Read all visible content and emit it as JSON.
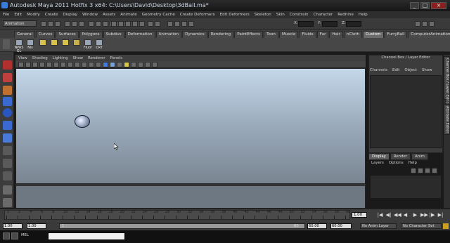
{
  "window": {
    "title": "Autodesk Maya 2011 Hotfix 3 x64: C:\\Users\\David\\Desktop\\3dBall.ma*",
    "buttons": [
      "_",
      "□",
      "×"
    ]
  },
  "menubar": [
    "File",
    "Edit",
    "Modify",
    "Create",
    "Display",
    "Window",
    "Assets",
    "Animate",
    "Geometry Cache",
    "Create Deformers",
    "Edit Deformers",
    "Skeleton",
    "Skin",
    "Constrain",
    "Character",
    "Redhine",
    "Help"
  ],
  "status_line": {
    "mode": "Animation",
    "x_label": "X:",
    "y_label": "Y:",
    "z_label": "Z:"
  },
  "shelf_tabs": [
    "General",
    "Curves",
    "Surfaces",
    "Polygons",
    "Subdivs",
    "Deformation",
    "Animation",
    "Dynamics",
    "Rendering",
    "PaintEffects",
    "Toon",
    "Muscle",
    "Fluids",
    "Fur",
    "Hair",
    "nCloth",
    "Custom",
    "FurryBall",
    "ComputerAnimation"
  ],
  "active_shelf_tab": "Custom",
  "shelf_items": [
    "NPRS GL",
    "Nls",
    "",
    "",
    "",
    "",
    "Fluor",
    "CRT"
  ],
  "panel_menu": [
    "View",
    "Shading",
    "Lighting",
    "Show",
    "Renderer",
    "Panels"
  ],
  "channel_box": {
    "title": "Channel Box / Layer Editor",
    "menu": [
      "Channels",
      "Edit",
      "Object",
      "Show"
    ]
  },
  "side_tabs": [
    "Channel Box / Layer Editor",
    "Attribute Editor"
  ],
  "layer_editor": {
    "tabs": [
      "Display",
      "Render",
      "Anim"
    ],
    "active_tab": "Display",
    "menu": [
      "Layers",
      "Options",
      "Help"
    ]
  },
  "time_slider": {
    "ticks": [
      "1",
      "2",
      "4",
      "6",
      "8",
      "10",
      "12",
      "14",
      "16",
      "18",
      "20",
      "22",
      "24",
      "26",
      "28",
      "30",
      "32",
      "34",
      "36",
      "38",
      "40",
      "42",
      "44",
      "46",
      "48",
      "50",
      "52",
      "54",
      "56",
      "58",
      "60"
    ],
    "current_frame": "1.00",
    "playback_buttons": [
      "|◀",
      "◀|",
      "◀◀",
      "◀",
      "▶",
      "▶▶",
      "|▶",
      "▶|"
    ]
  },
  "range_slider": {
    "start_field": "1.00",
    "start2_field": "1.00",
    "range_start": "1",
    "range_end": "60",
    "end_field": "60.00",
    "end2_field": "60.00",
    "anim_layer": "No Anim Layer",
    "char_set": "No Character Set"
  },
  "command_line": {
    "label": "MEL"
  }
}
